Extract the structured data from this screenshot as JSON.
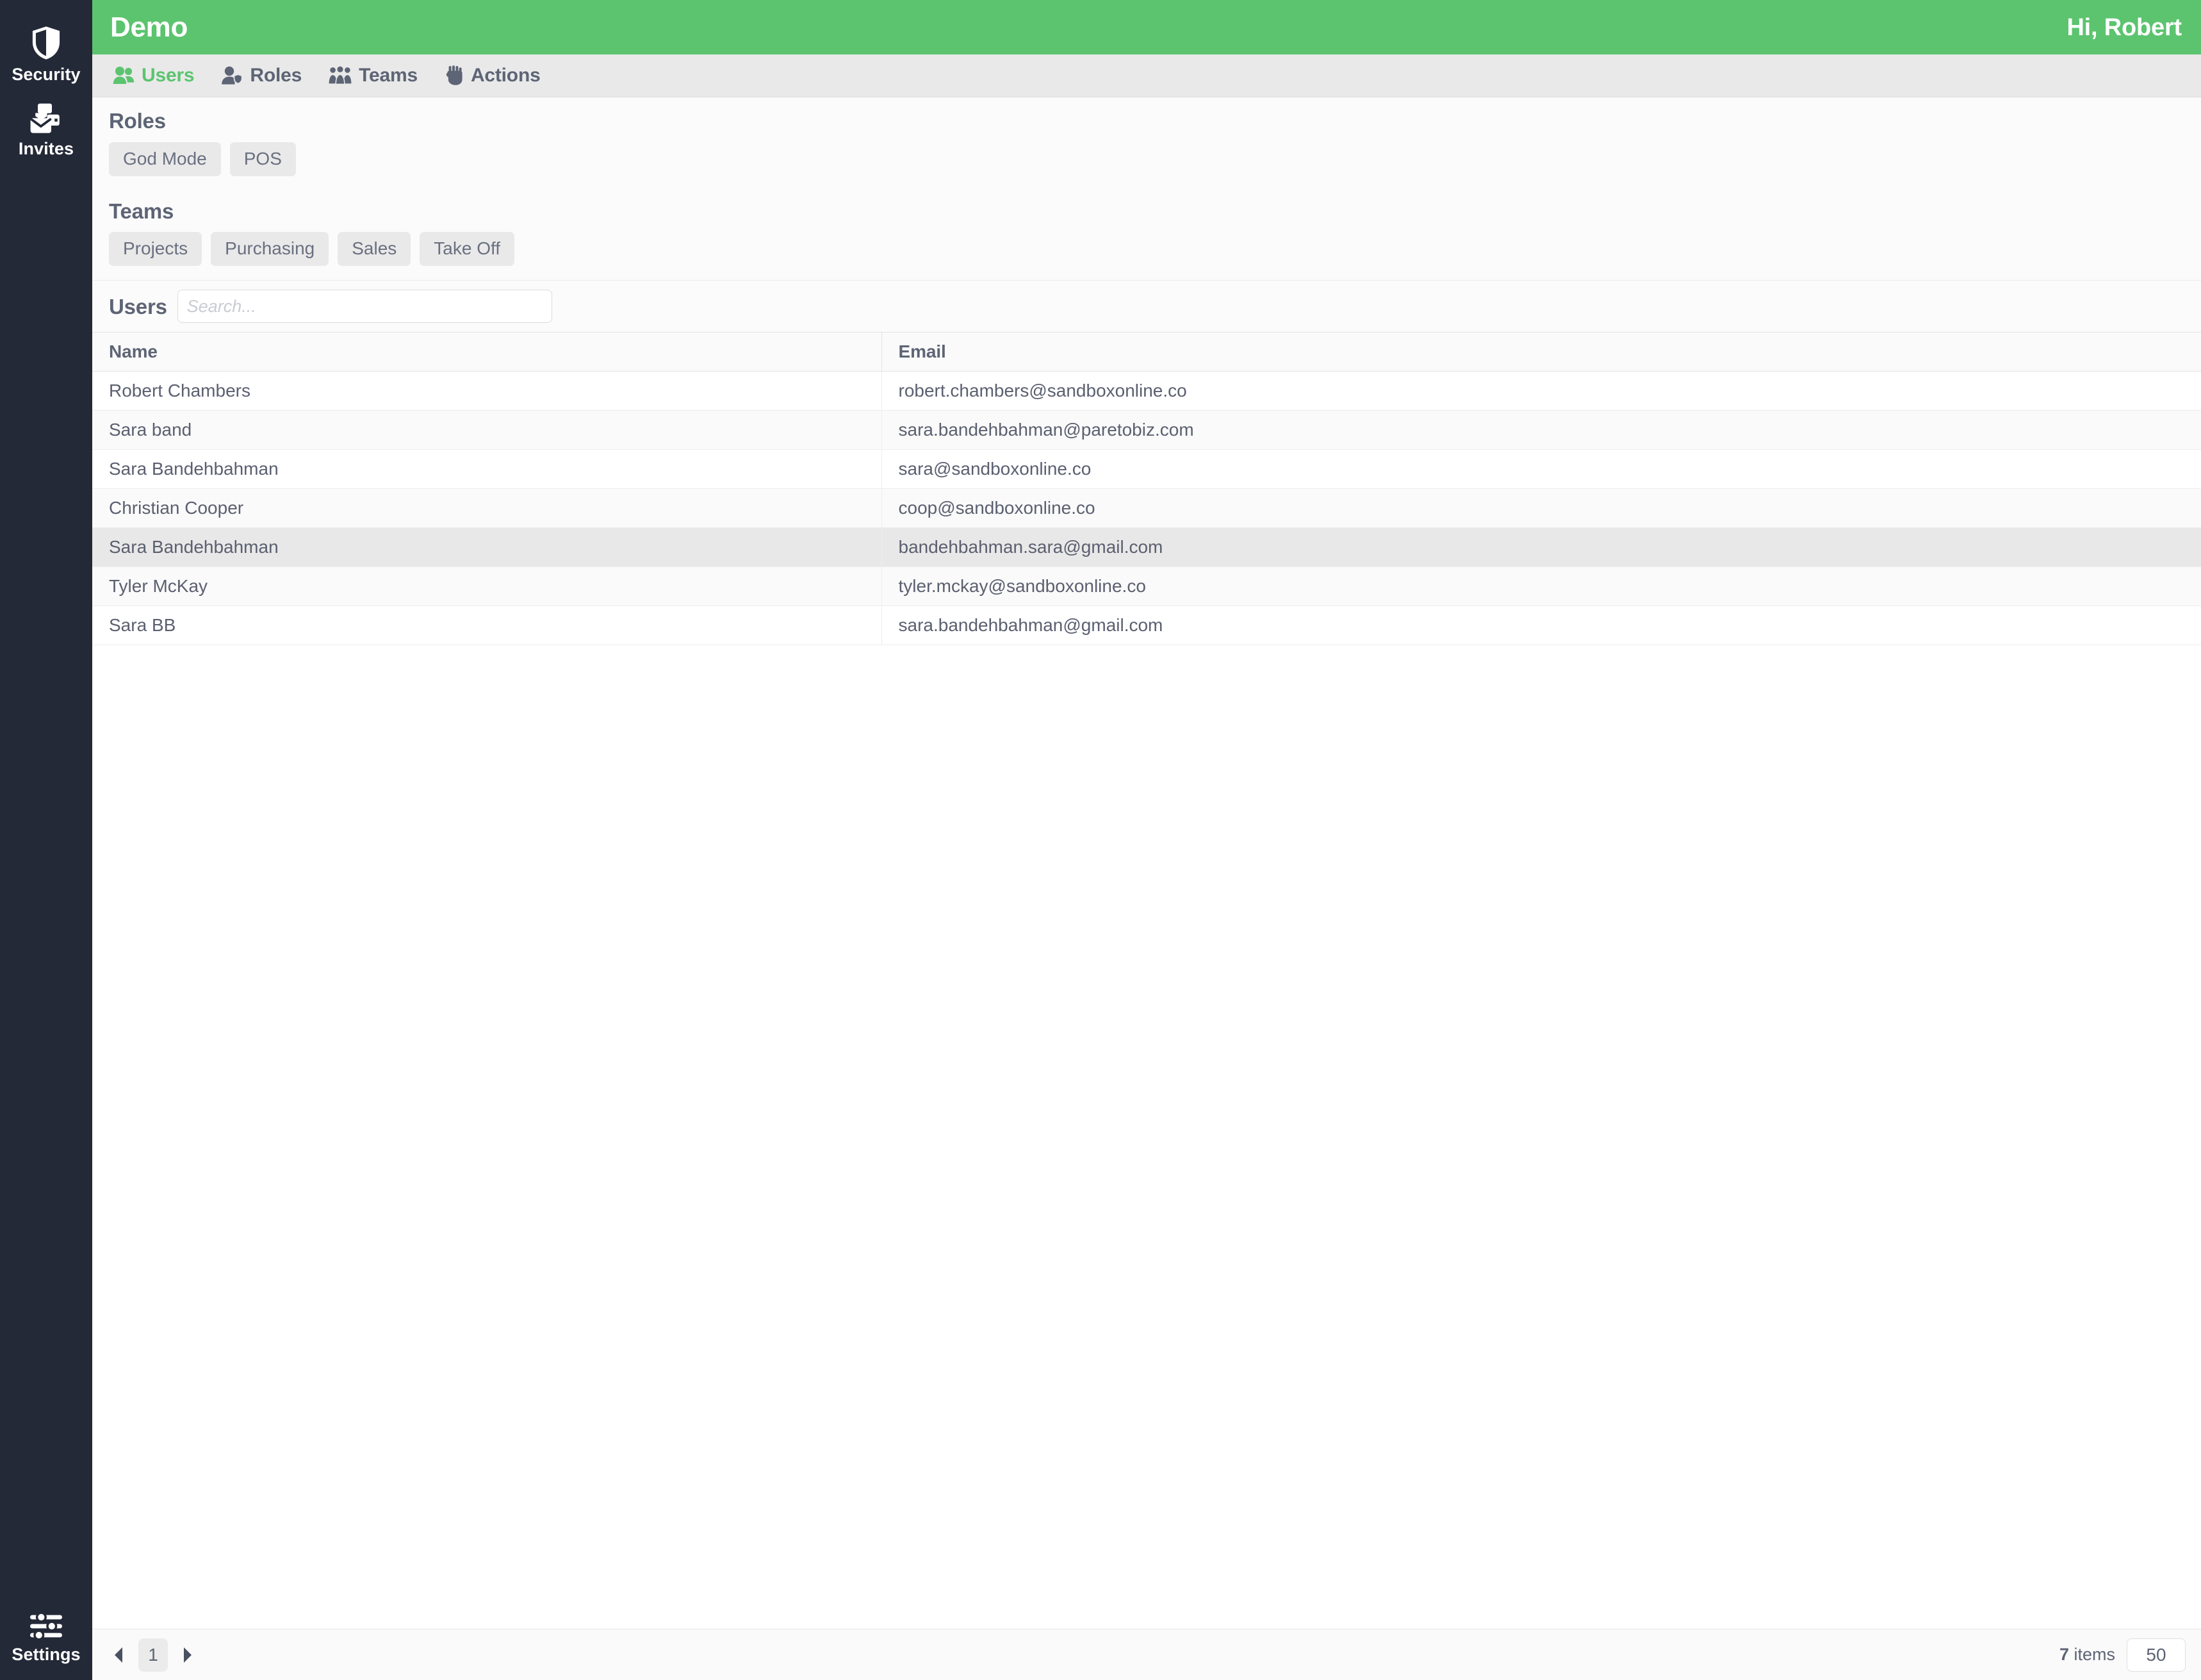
{
  "colors": {
    "brand_green": "#5cc46f",
    "rail_dark": "#242938",
    "text_gray": "#5d6475",
    "chip_gray": "#e9e9e9",
    "row_highlight": "#e8e8e8"
  },
  "rail": {
    "items": [
      {
        "label": "Security",
        "icon": "shield-icon"
      },
      {
        "label": "Invites",
        "icon": "envelopes-icon"
      }
    ],
    "bottom": {
      "label": "Settings",
      "icon": "sliders-icon"
    }
  },
  "topbar": {
    "title": "Demo",
    "greeting": "Hi, Robert"
  },
  "tabs": [
    {
      "label": "Users",
      "icon": "two-people-icon",
      "active": true
    },
    {
      "label": "Roles",
      "icon": "person-shield-icon",
      "active": false
    },
    {
      "label": "Teams",
      "icon": "people-group-icon",
      "active": false
    },
    {
      "label": "Actions",
      "icon": "raised-fist-icon",
      "active": false
    }
  ],
  "roles_section": {
    "heading": "Roles",
    "chips": [
      "God Mode",
      "POS"
    ]
  },
  "teams_section": {
    "heading": "Teams",
    "chips": [
      "Projects",
      "Purchasing",
      "Sales",
      "Take Off"
    ]
  },
  "users_section": {
    "heading": "Users",
    "search_placeholder": "Search...",
    "search_value": ""
  },
  "table": {
    "columns": [
      "Name",
      "Email"
    ],
    "rows": [
      {
        "name": "Robert Chambers",
        "email": "robert.chambers@sandboxonline.co",
        "highlight": false
      },
      {
        "name": "Sara band",
        "email": "sara.bandehbahman@paretobiz.com",
        "highlight": false
      },
      {
        "name": "Sara Bandehbahman",
        "email": "sara@sandboxonline.co",
        "highlight": false
      },
      {
        "name": "Christian Cooper",
        "email": "coop@sandboxonline.co",
        "highlight": false
      },
      {
        "name": "Sara Bandehbahman",
        "email": "bandehbahman.sara@gmail.com",
        "highlight": true
      },
      {
        "name": "Tyler McKay",
        "email": "tyler.mckay@sandboxonline.co",
        "highlight": false
      },
      {
        "name": "Sara BB",
        "email": "sara.bandehbahman@gmail.com",
        "highlight": false
      }
    ]
  },
  "footer": {
    "prev_icon": "triangle-left-icon",
    "next_icon": "triangle-right-icon",
    "current_page": "1",
    "items_count": "7",
    "items_label": " items",
    "page_size": "50"
  }
}
